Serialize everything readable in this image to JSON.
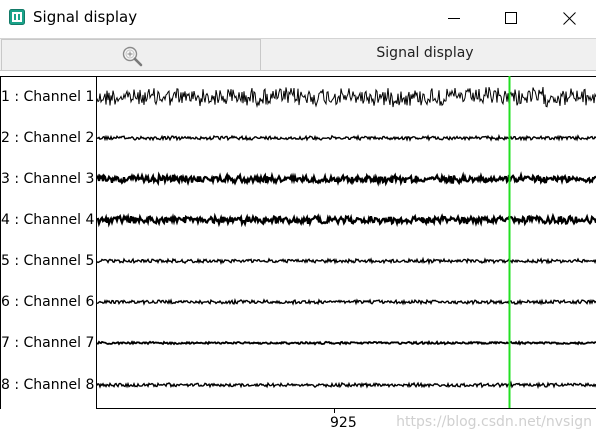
{
  "window": {
    "title": "Signal display",
    "app_icon": "signal-app-icon",
    "controls": [
      "minimize-icon",
      "maximize-icon",
      "close-icon"
    ]
  },
  "toolbar": {
    "zoom_icon": "zoom-icon",
    "title": "Signal display"
  },
  "plot": {
    "channels": [
      {
        "label": "1 : Channel 1",
        "amplitude": "high"
      },
      {
        "label": "2 : Channel 2",
        "amplitude": "low"
      },
      {
        "label": "3 : Channel 3",
        "amplitude": "medium"
      },
      {
        "label": "4 : Channel 4",
        "amplitude": "medium"
      },
      {
        "label": "5 : Channel 5",
        "amplitude": "low"
      },
      {
        "label": "6 : Channel 6",
        "amplitude": "low"
      },
      {
        "label": "7 : Channel 7",
        "amplitude": "very-low"
      },
      {
        "label": "8 : Channel 8",
        "amplitude": "low"
      }
    ],
    "x_tick": "925",
    "cursor_color": "#22e022",
    "trace_color": "#000000"
  },
  "watermark": "https://blog.csdn.net/nvsign"
}
